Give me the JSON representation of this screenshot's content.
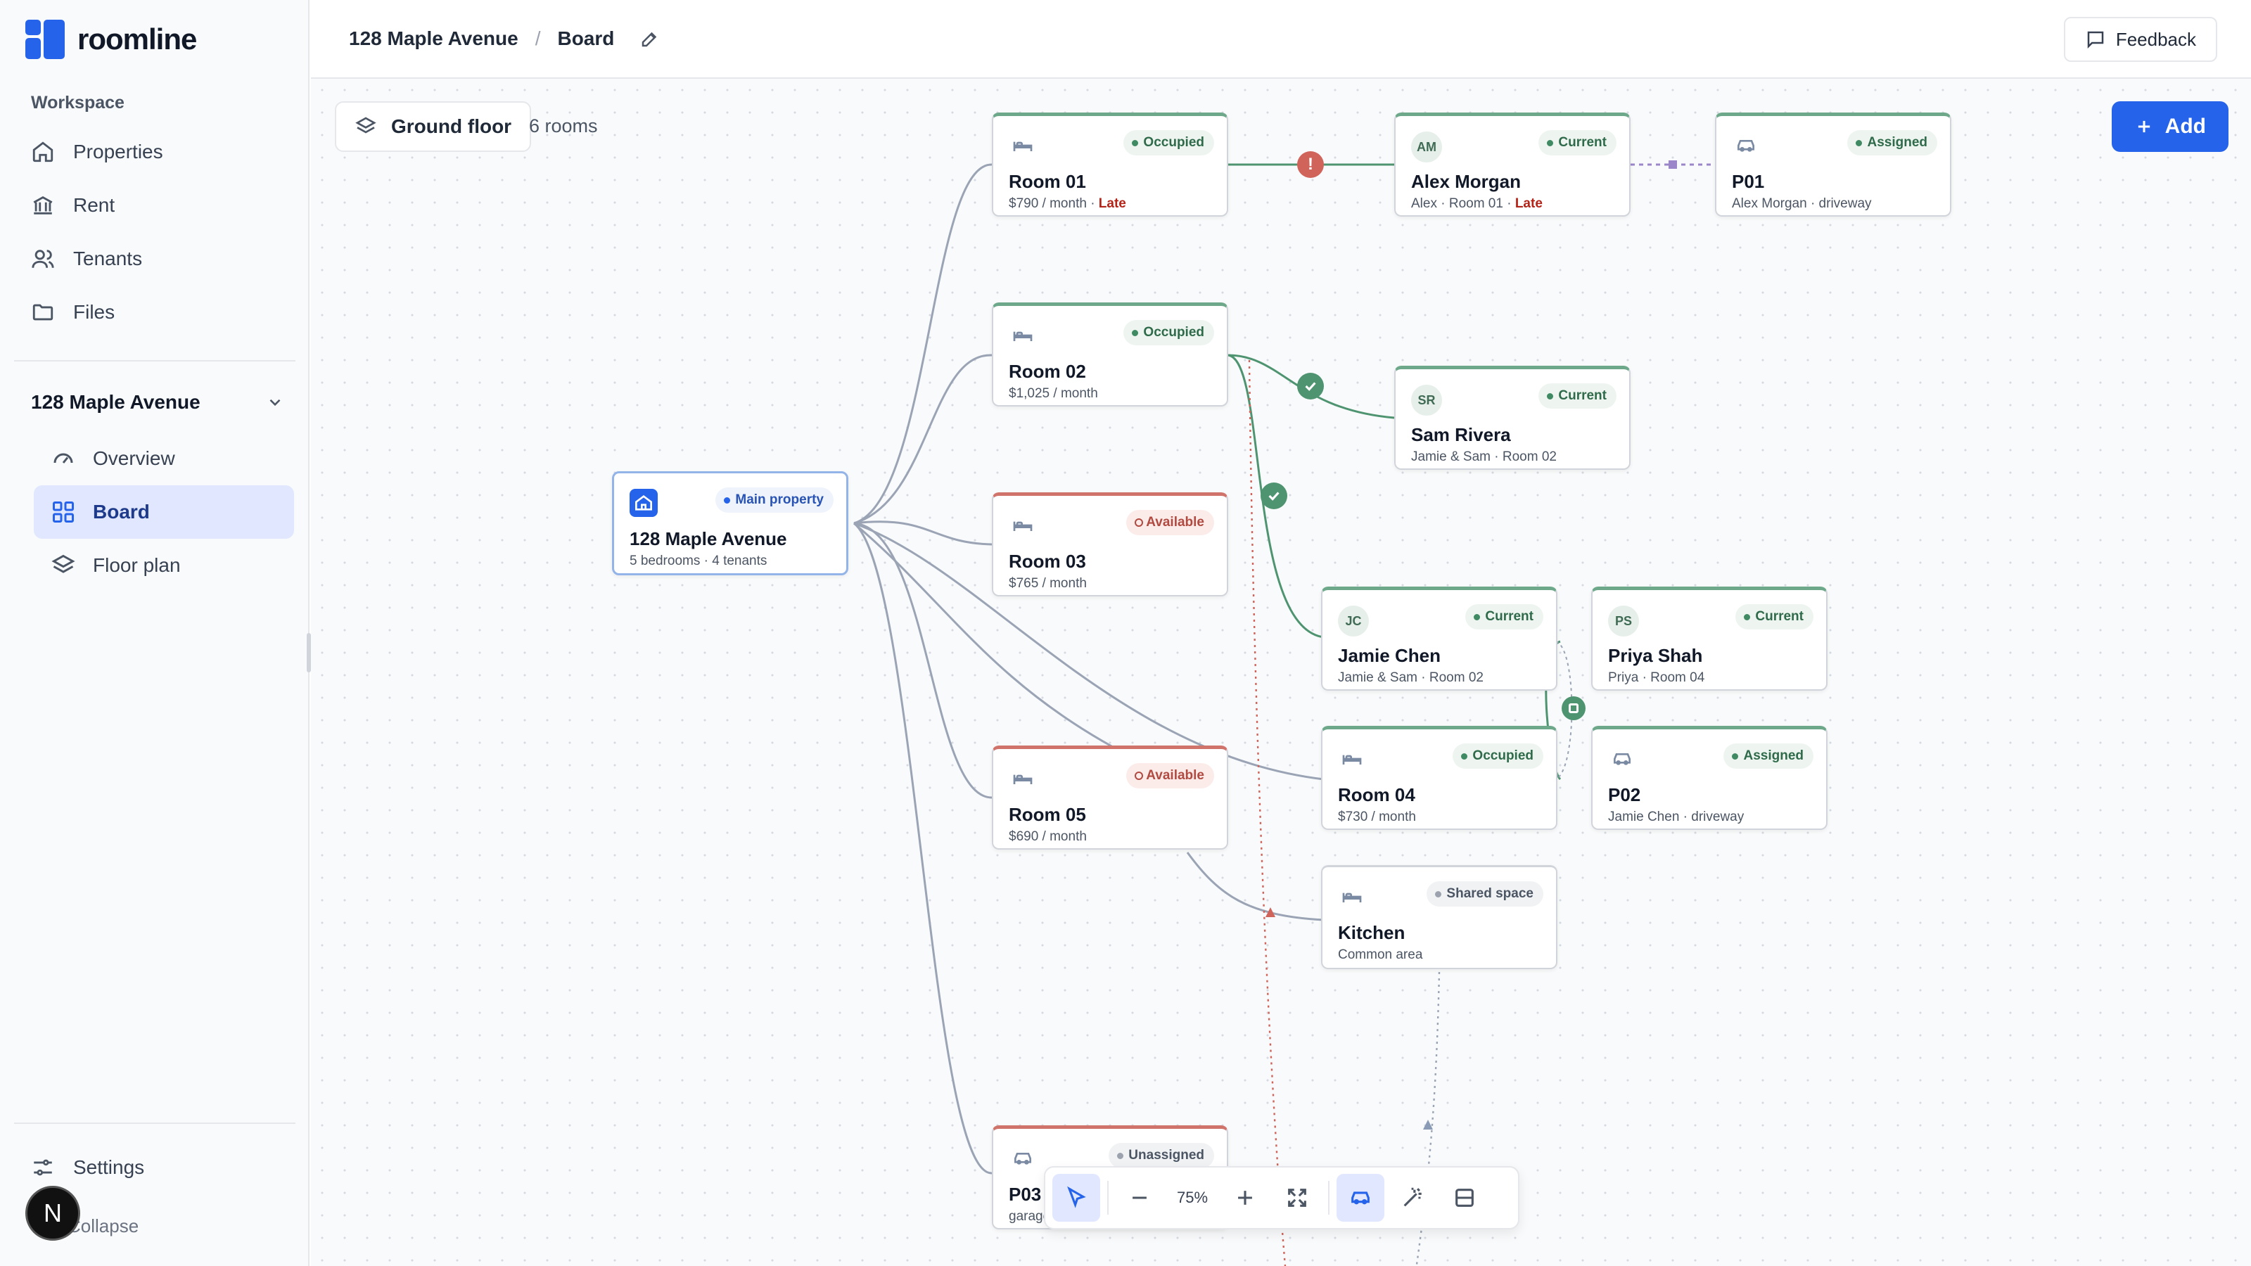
{
  "app": {
    "name": "roomline"
  },
  "sidebar": {
    "workspace_label": "Workspace",
    "items": [
      {
        "label": "Properties",
        "icon": "home-icon"
      },
      {
        "label": "Rent",
        "icon": "bank-icon"
      },
      {
        "label": "Tenants",
        "icon": "users-icon"
      },
      {
        "label": "Files",
        "icon": "folder-icon"
      }
    ],
    "property": {
      "name": "128 Maple Avenue",
      "items": [
        {
          "label": "Overview",
          "icon": "gauge-icon"
        },
        {
          "label": "Board",
          "icon": "grid-icon",
          "active": true
        },
        {
          "label": "Floor plan",
          "icon": "layers-icon"
        }
      ]
    },
    "settings_label": "Settings",
    "collapse_label": "Collapse",
    "avatar_initial": "N"
  },
  "header": {
    "crumb_property": "128 Maple Avenue",
    "separator": "/",
    "crumb_page": "Board",
    "feedback_label": "Feedback"
  },
  "canvas": {
    "floor_label": "Ground floor",
    "room_count": "6 rooms",
    "add_label": "Add",
    "cards": {
      "main": {
        "badge": "Main property",
        "title": "128 Maple Avenue",
        "meta": "5 bedrooms · 4 tenants"
      },
      "room01": {
        "badge": "Occupied",
        "title": "Room 01",
        "meta": "$790 / month · ",
        "meta_late": "Late"
      },
      "room02": {
        "badge": "Occupied",
        "title": "Room 02",
        "meta": "$1,025 / month"
      },
      "room03": {
        "badge": "Available",
        "title": "Room 03",
        "meta": "$765 / month"
      },
      "room05": {
        "badge": "Available",
        "title": "Room 05",
        "meta": "$690 / month"
      },
      "p03": {
        "badge": "Unassigned",
        "title": "P03",
        "meta": "garage"
      },
      "alex": {
        "initials": "AM",
        "badge": "Current",
        "title": "Alex Morgan",
        "meta": "Alex · Room 01 · ",
        "meta_late": "Late"
      },
      "p01": {
        "badge": "Assigned",
        "title": "P01",
        "meta": "Alex Morgan · driveway"
      },
      "sam": {
        "initials": "SR",
        "badge": "Current",
        "title": "Sam Rivera",
        "meta": "Jamie & Sam · Room 02"
      },
      "jamie": {
        "initials": "JC",
        "badge": "Current",
        "title": "Jamie Chen",
        "meta": "Jamie & Sam · Room 02"
      },
      "priya": {
        "initials": "PS",
        "badge": "Current",
        "title": "Priya Shah",
        "meta": "Priya · Room 04"
      },
      "room04": {
        "badge": "Occupied",
        "title": "Room 04",
        "meta": "$730 / month"
      },
      "p02": {
        "badge": "Assigned",
        "title": "P02",
        "meta": "Jamie Chen · driveway"
      },
      "kitchen": {
        "badge": "Shared space",
        "title": "Kitchen",
        "meta": "Common area"
      }
    },
    "markers": {
      "warning": "!"
    }
  },
  "toolbar": {
    "zoom": "75%"
  },
  "colors": {
    "accent": "#2563eb",
    "occupied": "#3f8a62",
    "available": "#b14a40",
    "edge": "#9aa4b5"
  }
}
